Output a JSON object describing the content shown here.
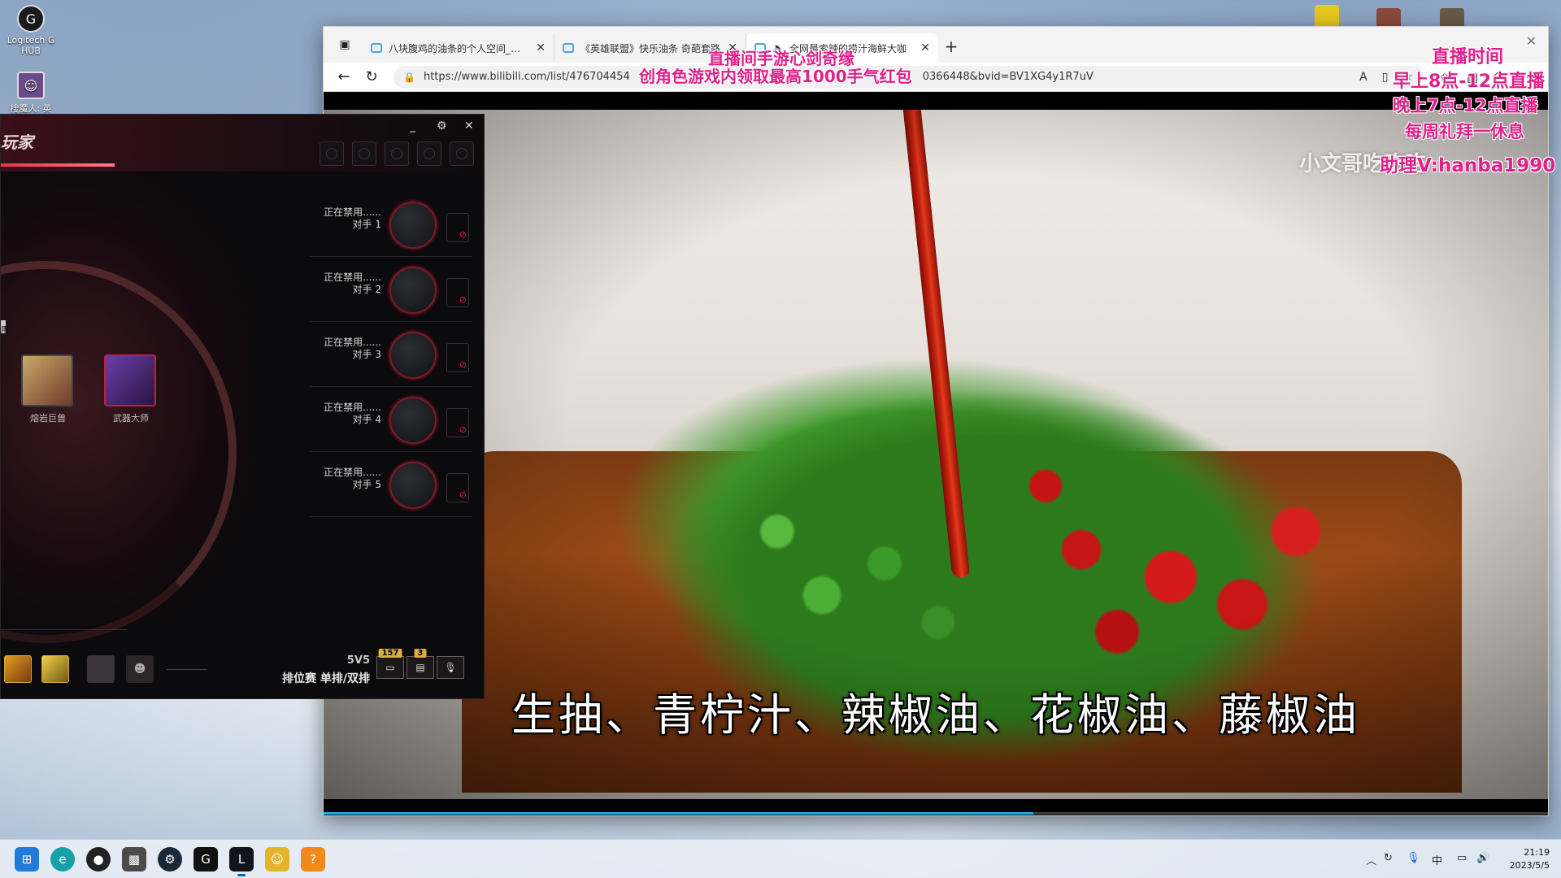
{
  "desktop": {
    "icons": [
      {
        "label": "Logitech G HUB"
      },
      {
        "label": "搜魔人: 英"
      }
    ]
  },
  "browser": {
    "tabs": [
      {
        "title": "八块腹鸡的油条的个人空间_哔哩",
        "active": false
      },
      {
        "title": "《英雄联盟》快乐油条 奇葩套路",
        "active": false
      },
      {
        "title": "全网最索辣的捞汁海鲜大咖",
        "active": true
      }
    ],
    "url": "https://www.bilibili.com/list/476704454",
    "url_tail": "0366448&bvid=BV1XG4y1R7uV"
  },
  "video": {
    "watermark": "小文哥吃吃吃",
    "subtitle": "生抽、青柠汁、辣椒油、花椒油、藤椒油",
    "progress": 0.58
  },
  "overlay": {
    "promo_line1": "直播间手游心剑奇缘",
    "promo_line2": "创角色游戏内领取最高1000手气红包",
    "schedule_title": "直播时间",
    "schedule_morning": "早上8点-12点直播",
    "schedule_evening": "晚上7点-12点直播",
    "schedule_rest": "每周礼拜一休息",
    "assistant": "助理V:hanba1990"
  },
  "game": {
    "title": "玩家",
    "left_tag": "用",
    "champions": [
      {
        "name": "熔岩巨兽"
      },
      {
        "name": "武器大师"
      }
    ],
    "opponents": [
      {
        "status": "正在禁用......",
        "label": "对手 1"
      },
      {
        "status": "正在禁用......",
        "label": "对手 2"
      },
      {
        "status": "正在禁用......",
        "label": "对手 3"
      },
      {
        "status": "正在禁用......",
        "label": "对手 4"
      },
      {
        "status": "正在禁用......",
        "label": "对手 5"
      }
    ],
    "mode": "5V5",
    "queue": "排位赛 单排/双排",
    "chat_badge": "157",
    "lobby_badge": "3"
  },
  "taskbar": {
    "time": "21:19",
    "date": "2023/5/5",
    "ime": "中"
  },
  "colors": {
    "overlay_pink": "#e0218a",
    "game_accent": "#d11b3b",
    "progress": "#23ade5"
  }
}
